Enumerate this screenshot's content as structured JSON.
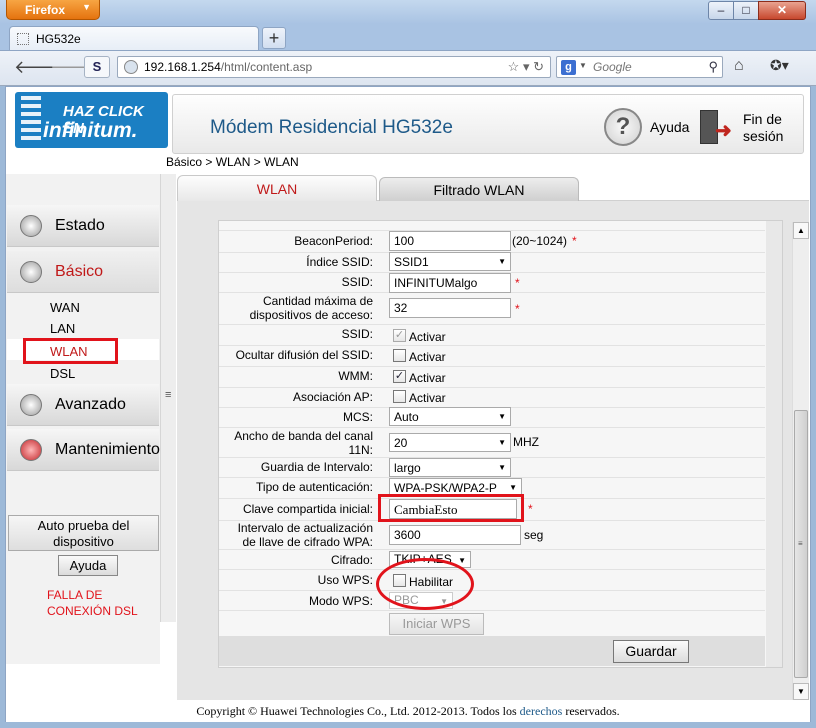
{
  "browser": {
    "app_button": "Firefox",
    "tab_title": "HG532e",
    "url_host": "192.168.1.254",
    "url_path": "/html/content.asp",
    "search_placeholder": "Google",
    "search_engine_glyph": "g"
  },
  "header": {
    "logo_line1": "HAZ CLICK EN",
    "logo_line2": "infinitum.",
    "title": "Módem Residencial HG532e",
    "help": "Ayuda",
    "logout_line1": "Fin de",
    "logout_line2": "sesión"
  },
  "breadcrumb": "Básico > WLAN > WLAN",
  "sidebar": {
    "estado": "Estado",
    "basico": "Básico",
    "sub": [
      "WAN",
      "LAN",
      "WLAN",
      "DSL"
    ],
    "avanzado": "Avanzado",
    "mantenimiento": "Mantenimiento",
    "autotest_1": "Auto prueba del",
    "autotest_2": "dispositivo",
    "ayuda": "Ayuda",
    "dsl_fail_1": "FALLA DE",
    "dsl_fail_2": "CONEXIÓN DSL"
  },
  "tabs": {
    "wlan": "WLAN",
    "filtrado": "Filtrado WLAN"
  },
  "form": {
    "beacon_label": "BeaconPeriod:",
    "beacon_value": "100",
    "beacon_hint": "(20~1024)",
    "ssid_index_label": "Índice SSID:",
    "ssid_index_value": "SSID1",
    "ssid_label": "SSID:",
    "ssid_value": "INFINITUMalgo",
    "maxdev_label_1": "Cantidad máxima de",
    "maxdev_label_2": "dispositivos de acceso:",
    "maxdev_value": "32",
    "ssid_enable_label": "SSID:",
    "activar": "Activar",
    "hide_label": "Ocultar difusión del SSID:",
    "wmm_label": "WMM:",
    "ap_assoc_label": "Asociación AP:",
    "mcs_label": "MCS:",
    "mcs_value": "Auto",
    "bw_label_1": "Ancho de banda del canal",
    "bw_label_2": "11N:",
    "bw_value": "20",
    "bw_unit": "MHZ",
    "gi_label": "Guardia de Intervalo:",
    "gi_value": "largo",
    "auth_label": "Tipo de autenticación:",
    "auth_value": "WPA-PSK/WPA2-P",
    "psk_label": "Clave compartida inicial:",
    "psk_value": "CambiaEsto",
    "rekey_label_1": "Intervalo de actualización",
    "rekey_label_2": "de llave de cifrado WPA:",
    "rekey_value": "3600",
    "rekey_unit": "seg",
    "cipher_label": "Cifrado:",
    "cipher_value": "TKIP+AES",
    "wps_label": "Uso WPS:",
    "wps_enable": "Habilitar",
    "wps_mode_label": "Modo WPS:",
    "wps_mode_value": "PBC",
    "start_wps": "Iniciar WPS",
    "save": "Guardar",
    "required_mark": "*"
  },
  "footer": {
    "pre": "Copyright © Huawei Technologies Co., Ltd. 2012-2013. Todos los ",
    "link": "derechos",
    "post": " reservados."
  }
}
